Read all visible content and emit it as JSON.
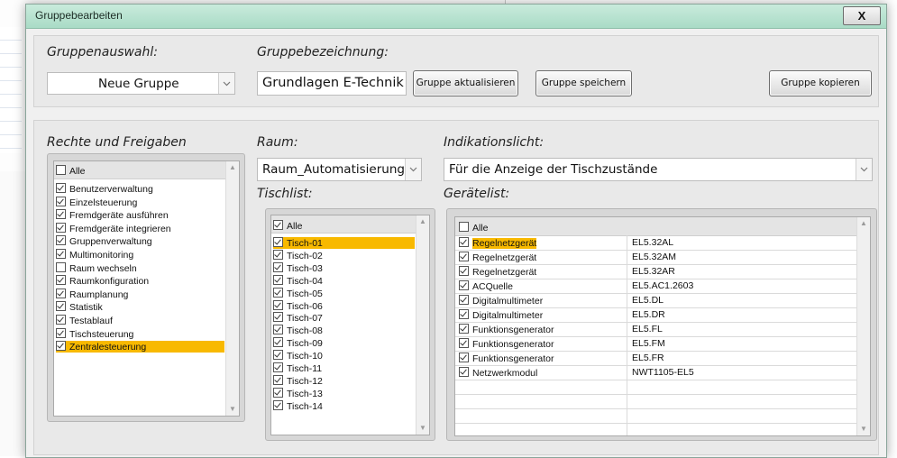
{
  "window": {
    "title": "Gruppebearbeiten",
    "close_label": "X"
  },
  "top": {
    "gruppenauswahl_label": "Gruppenauswahl:",
    "gruppenauswahl_value": "Neue Gruppe",
    "gruppenbezeichnung_label": "Gruppebezeichnung:",
    "gruppenbezeichnung_value": "Grundlagen E-Technik",
    "btn_aktualisieren": "Gruppe aktualisieren",
    "btn_speichern": "Gruppe speichern",
    "btn_kopieren": "Gruppe kopieren"
  },
  "rechte": {
    "label": "Rechte und Freigaben",
    "all_label": "Alle",
    "items": [
      {
        "label": "Benutzerverwaltung",
        "checked": true
      },
      {
        "label": "Einzelsteuerung",
        "checked": true
      },
      {
        "label": "Fremdgeräte ausführen",
        "checked": true
      },
      {
        "label": "Fremdgeräte integrieren",
        "checked": true
      },
      {
        "label": "Gruppenverwaltung",
        "checked": true
      },
      {
        "label": "Multimonitoring",
        "checked": true
      },
      {
        "label": "Raum wechseln",
        "checked": false
      },
      {
        "label": "Raumkonfiguration",
        "checked": true
      },
      {
        "label": "Raumplanung",
        "checked": true
      },
      {
        "label": "Statistik",
        "checked": true
      },
      {
        "label": "Testablauf",
        "checked": true
      },
      {
        "label": "Tischsteuerung",
        "checked": true
      },
      {
        "label": "Zentralesteuerung",
        "checked": true,
        "selected": true
      }
    ]
  },
  "raum": {
    "label": "Raum:",
    "value": "Raum_Automatisierungs"
  },
  "tischlist": {
    "label": "Tischlist:",
    "all_label": "Alle",
    "items": [
      "Tisch-01",
      "Tisch-02",
      "Tisch-03",
      "Tisch-04",
      "Tisch-05",
      "Tisch-06",
      "Tisch-07",
      "Tisch-08",
      "Tisch-09",
      "Tisch-10",
      "Tisch-11",
      "Tisch-12",
      "Tisch-13",
      "Tisch-14"
    ],
    "selected_index": 0
  },
  "indikation": {
    "label": "Indikationslicht:",
    "value": "Für die Anzeige der Tischzustände"
  },
  "geraete": {
    "label": "Gerätelist:",
    "all_label": "Alle",
    "items": [
      {
        "name": "Regelnetzgerät",
        "id": "EL5.32AL",
        "selected": true
      },
      {
        "name": "Regelnetzgerät",
        "id": "EL5.32AM"
      },
      {
        "name": "Regelnetzgerät",
        "id": "EL5.32AR"
      },
      {
        "name": "ACQuelle",
        "id": "EL5.AC1.2603"
      },
      {
        "name": "Digitalmultimeter",
        "id": "EL5.DL"
      },
      {
        "name": "Digitalmultimeter",
        "id": "EL5.DR"
      },
      {
        "name": "Funktionsgenerator",
        "id": "EL5.FL"
      },
      {
        "name": "Funktionsgenerator",
        "id": "EL5.FM"
      },
      {
        "name": "Funktionsgenerator",
        "id": "EL5.FR"
      },
      {
        "name": "Netzwerkmodul",
        "id": "NWT1105-EL5"
      }
    ]
  },
  "colors": {
    "selection": "#f8b900",
    "titlebar": "#b6e2cf"
  }
}
